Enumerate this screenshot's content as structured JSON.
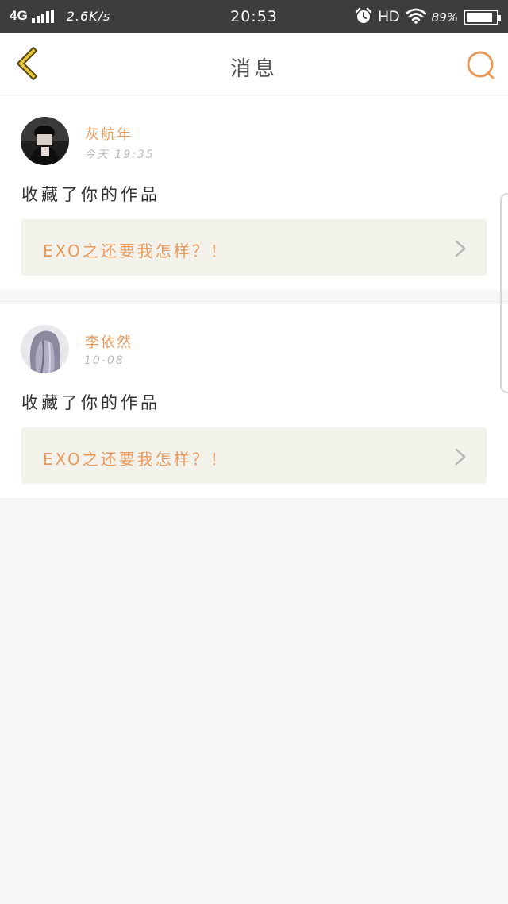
{
  "status_bar": {
    "network": "4G",
    "speed": "2.6K/s",
    "time": "20:53",
    "hd": "HD",
    "battery_text": "89%",
    "battery_level": 0.89
  },
  "nav": {
    "title": "消息"
  },
  "messages": [
    {
      "name": "灰航年",
      "time": "今天 19:35",
      "action": "收藏了你的作品",
      "work": "EXO之还要我怎样？！"
    },
    {
      "name": "李依然",
      "time": "10-08",
      "action": "收藏了你的作品",
      "work": "EXO之还要我怎样？！"
    }
  ],
  "colors": {
    "accent": "#e89a5c",
    "back_icon": "#e8c93a",
    "status_bar": "#3d3d3d",
    "link_bg": "#f2f1ea"
  },
  "icons": {
    "back": "chevron-left-icon",
    "search": "search-icon",
    "alarm": "alarm-icon",
    "wifi": "wifi-icon",
    "battery": "battery-icon",
    "signal": "signal-icon",
    "chevron": "chevron-right-icon"
  }
}
